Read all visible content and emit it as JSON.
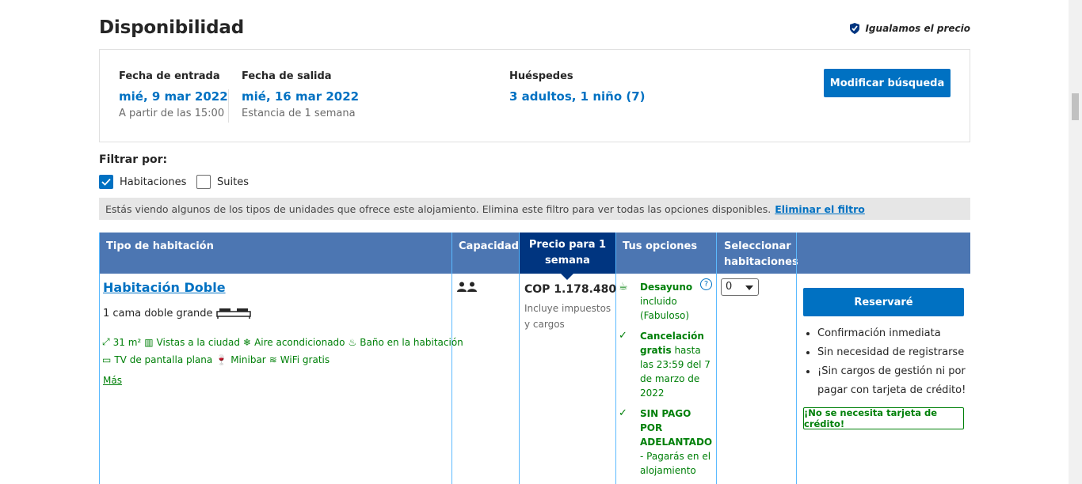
{
  "header": {
    "title": "Disponibilidad",
    "price_match": "Igualamos el precio"
  },
  "search": {
    "checkin_label": "Fecha de entrada",
    "checkin_value": "mié, 9 mar 2022",
    "checkin_sub": "A partir de las 15:00",
    "checkout_label": "Fecha de salida",
    "checkout_value": "mié, 16 mar 2022",
    "checkout_sub": "Estancia de 1 semana",
    "guests_label": "Huéspedes",
    "guests_value": "3 adultos, 1 niño (7)",
    "modify_button": "Modificar búsqueda"
  },
  "filter": {
    "title": "Filtrar por:",
    "options": [
      {
        "label": "Habitaciones",
        "checked": true
      },
      {
        "label": "Suites",
        "checked": false
      }
    ],
    "notice": "Estás viendo algunos de los tipos de unidades que ofrece este alojamiento. Elimina este filtro para ver todas las opciones disponibles.",
    "remove_link": "Eliminar el filtro"
  },
  "table": {
    "headers": {
      "room_type": "Tipo de habitación",
      "capacity": "Capacidad",
      "price": "Precio para 1 semana",
      "options": "Tus opciones",
      "select": "Seleccionar habitaciones"
    },
    "room": {
      "name": "Habitación Doble",
      "bed": "1 cama doble grande",
      "facilities_row1": [
        "31 m²",
        "Vistas a la ciudad",
        "Aire acondicionado",
        "Baño en la habitación"
      ],
      "facilities_row2": [
        "TV de pantalla plana",
        "Minibar",
        "WiFi gratis"
      ],
      "more": "Más",
      "price": "COP 1.178.480",
      "price_sub": "Incluye impuestos y cargos",
      "opt1_bold": "Desayuno",
      "opt1_rest": "incluido (Fabuloso)",
      "opt2_bold": "Cancelación gratis",
      "opt2_rest": "hasta las 23:59 del 7 de marzo de 2022",
      "opt3_bold": "SIN PAGO POR ADELANTADO",
      "opt3_rest": "- Pagarás en el alojamiento",
      "select_value": "0",
      "reserve_button": "Reservaré",
      "bullets": [
        "Confirmación inmediata",
        "Sin necesidad de registrarse",
        "¡Sin cargos de gestión ni por pagar con tarjeta de crédito!"
      ],
      "no_card": "¡No se necesita tarjeta de crédito!"
    }
  },
  "colors": {
    "brand_blue": "#0071c2",
    "header_blue": "#4c76b2",
    "dark_blue": "#003580",
    "green": "#008009"
  }
}
